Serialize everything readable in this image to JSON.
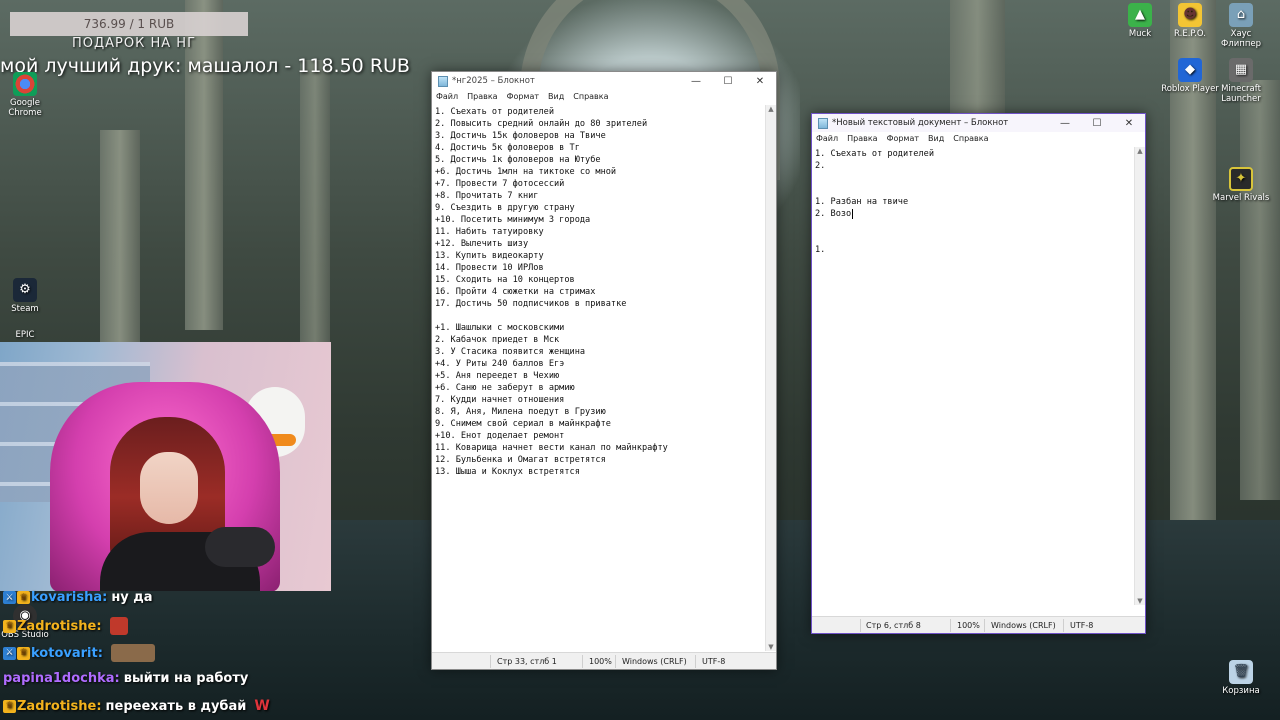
{
  "donation": {
    "goal": "736.99 / 1 RUB",
    "goal_title": "ПОДАРОК НА НГ",
    "top_donor": "мой лучший друк: машалол - 118.50 RUB"
  },
  "desktop_icons": [
    {
      "name": "Google Chrome",
      "color": "#2f8de4"
    },
    {
      "name": "Steam",
      "color": "#1b2838"
    },
    {
      "name": "EPIC",
      "color": "#222"
    },
    {
      "name": "OBS Studio",
      "color": "#303030"
    },
    {
      "name": "Muck",
      "color": "#3bb24a"
    },
    {
      "name": "R.E.P.O.",
      "color": "#f3c534"
    },
    {
      "name": "Хаус Флиппер",
      "color": "#7aa0b8"
    },
    {
      "name": "Roblox Player",
      "color": "#2166d6"
    },
    {
      "name": "Minecraft Launcher",
      "color": "#6a6a6a"
    },
    {
      "name": "Marvel Rivals",
      "color": "#d8c43a"
    },
    {
      "name": "Корзина",
      "color": "#bcd3e6"
    }
  ],
  "notepad_main": {
    "title": "*нг2025 – Блокнот",
    "menu": [
      "Файл",
      "Правка",
      "Формат",
      "Вид",
      "Справка"
    ],
    "lines": [
      "1. Съехать от родителей",
      "2. Повысить средний онлайн до 80 зрителей",
      "3. Достичь 15к фоловеров на Твиче",
      "4. Достичь 5к фоловеров в Тг",
      "5. Достичь 1к фоловеров на Ютубе",
      "+6. Достичь 1млн на тиктоке со мной",
      "+7. Провести 7 фотосессий",
      "+8. Прочитать 7 книг",
      "9. Съездить в другую страну",
      "+10. Посетить минимум 3 города",
      "11. Набить татуировку",
      "+12. Вылечить шизу",
      "13. Купить видеокарту",
      "14. Провести 10 ИРЛов",
      "15. Сходить на 10 концертов",
      "16. Пройти 4 сюжетки на стримах",
      "17. Достичь 50 подписчиков в приватке",
      "",
      "+1. Шашлыки с московскими",
      "2. Кабачок приедет в Мск",
      "3. У Стасика появится женщина",
      "+4. У Риты 240 баллов Егэ",
      "+5. Аня переедет в Чехию",
      "+6. Саню не заберут в армию",
      "7. Кудди начнет отношения",
      "8. Я, Аня, Милена поедут в Грузию",
      "9. Снимем свой сериал в майнкрафте",
      "+10. Енот доделает ремонт",
      "11. Коварища начнет вести канал по майнкрафту",
      "12. Бульбенка и Омагат встретятся",
      "13. Шыша и Коклух встретятся"
    ],
    "status": {
      "position": "Стр 33, стлб 1",
      "zoom": "100%",
      "eol": "Windows (CRLF)",
      "encoding": "UTF-8"
    }
  },
  "notepad_new": {
    "title": "*Новый текстовый документ – Блокнот",
    "menu": [
      "Файл",
      "Правка",
      "Формат",
      "Вид",
      "Справка"
    ],
    "lines": [
      "1. Съехать от родителей",
      "2.",
      "",
      "",
      "1. Разбан на твиче",
      "2. Возо",
      "",
      "",
      "1."
    ],
    "status": {
      "position": "Стр 6, стлб 8",
      "zoom": "100%",
      "eol": "Windows (CRLF)",
      "encoding": "UTF-8"
    }
  },
  "window_controls": {
    "minimize": "—",
    "maximize": "☐",
    "close": "✕"
  },
  "scroll_arrows": {
    "up": "▲",
    "down": "▼"
  },
  "chat": [
    {
      "user": "kovarisha",
      "user_color": "#3aa0ff",
      "message": "ну да",
      "emote": false
    },
    {
      "user": "Zadrotishe",
      "user_color": "#f3b31d",
      "message": "",
      "emote": true,
      "emote_color": "#c0392b"
    },
    {
      "user": "kotovarit",
      "user_color": "#3aa0ff",
      "message": "",
      "emote": true,
      "emote_color": "#8a6a4a"
    },
    {
      "user": "papina1dochka",
      "user_color": "#b06cff",
      "message": "выйти на работу",
      "emote": false
    },
    {
      "user": "Zadrotishe",
      "user_color": "#f3b31d",
      "message": "переехать в дубай",
      "emote": false,
      "suffix": "W"
    }
  ]
}
